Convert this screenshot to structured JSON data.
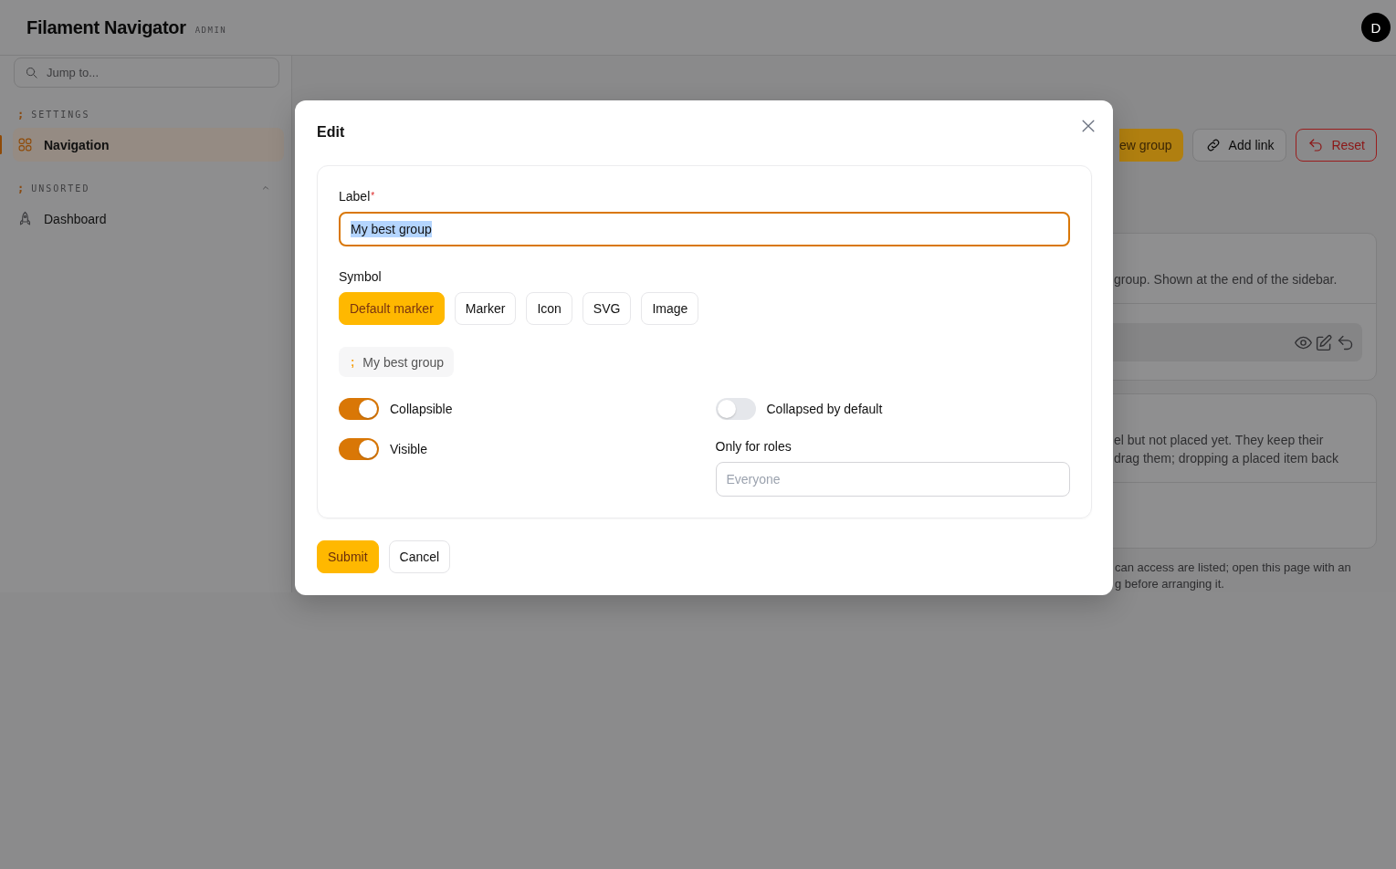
{
  "app": {
    "title": "Filament Navigator",
    "badge": "ADMIN",
    "avatar": "D"
  },
  "sidebar": {
    "search_placeholder": "Jump to...",
    "groups": [
      {
        "marker": ";",
        "label": "SETTINGS",
        "collapsible": false,
        "items": [
          {
            "label": "Navigation",
            "selected": true
          }
        ]
      },
      {
        "marker": ";",
        "label": "UNSORTED",
        "collapsible": true,
        "items": [
          {
            "label": "Dashboard",
            "selected": false
          }
        ]
      }
    ]
  },
  "main": {
    "actions": [
      {
        "label": "ew group",
        "kind": "primary"
      },
      {
        "label": "Add link",
        "kind": "link"
      },
      {
        "label": "Reset",
        "kind": "danger"
      }
    ],
    "cards": [
      {
        "lines": [
          "group. Shown at the end of the sidebar."
        ],
        "kind": "item-row"
      },
      {
        "lines": [
          "el but not placed yet. They keep their",
          "drag them; dropping a placed item back"
        ],
        "kind": "empty"
      }
    ],
    "footnote": [
      "can access are listed; open this page with an",
      "g before arranging it."
    ]
  },
  "modal": {
    "title": "Edit",
    "label_field": {
      "label": "Label",
      "required_mark": "*",
      "value": "My best group",
      "highlighted": true
    },
    "symbol": {
      "label": "Symbol",
      "options": [
        {
          "label": "Default marker",
          "selected": true
        },
        {
          "label": "Marker",
          "selected": false
        },
        {
          "label": "Icon",
          "selected": false
        },
        {
          "label": "SVG",
          "selected": false
        },
        {
          "label": "Image",
          "selected": false
        }
      ]
    },
    "preview": {
      "marker": ";",
      "label": "My best group"
    },
    "toggles": [
      {
        "label": "Collapsible",
        "on": true
      },
      {
        "label": "Collapsed by default",
        "on": false
      },
      {
        "label": "Visible",
        "on": true
      }
    ],
    "roles": {
      "label": "Only for roles",
      "placeholder": "Everyone"
    },
    "buttons": [
      {
        "label": "Submit",
        "kind": "primary"
      },
      {
        "label": "Cancel",
        "kind": "secondary"
      }
    ]
  }
}
